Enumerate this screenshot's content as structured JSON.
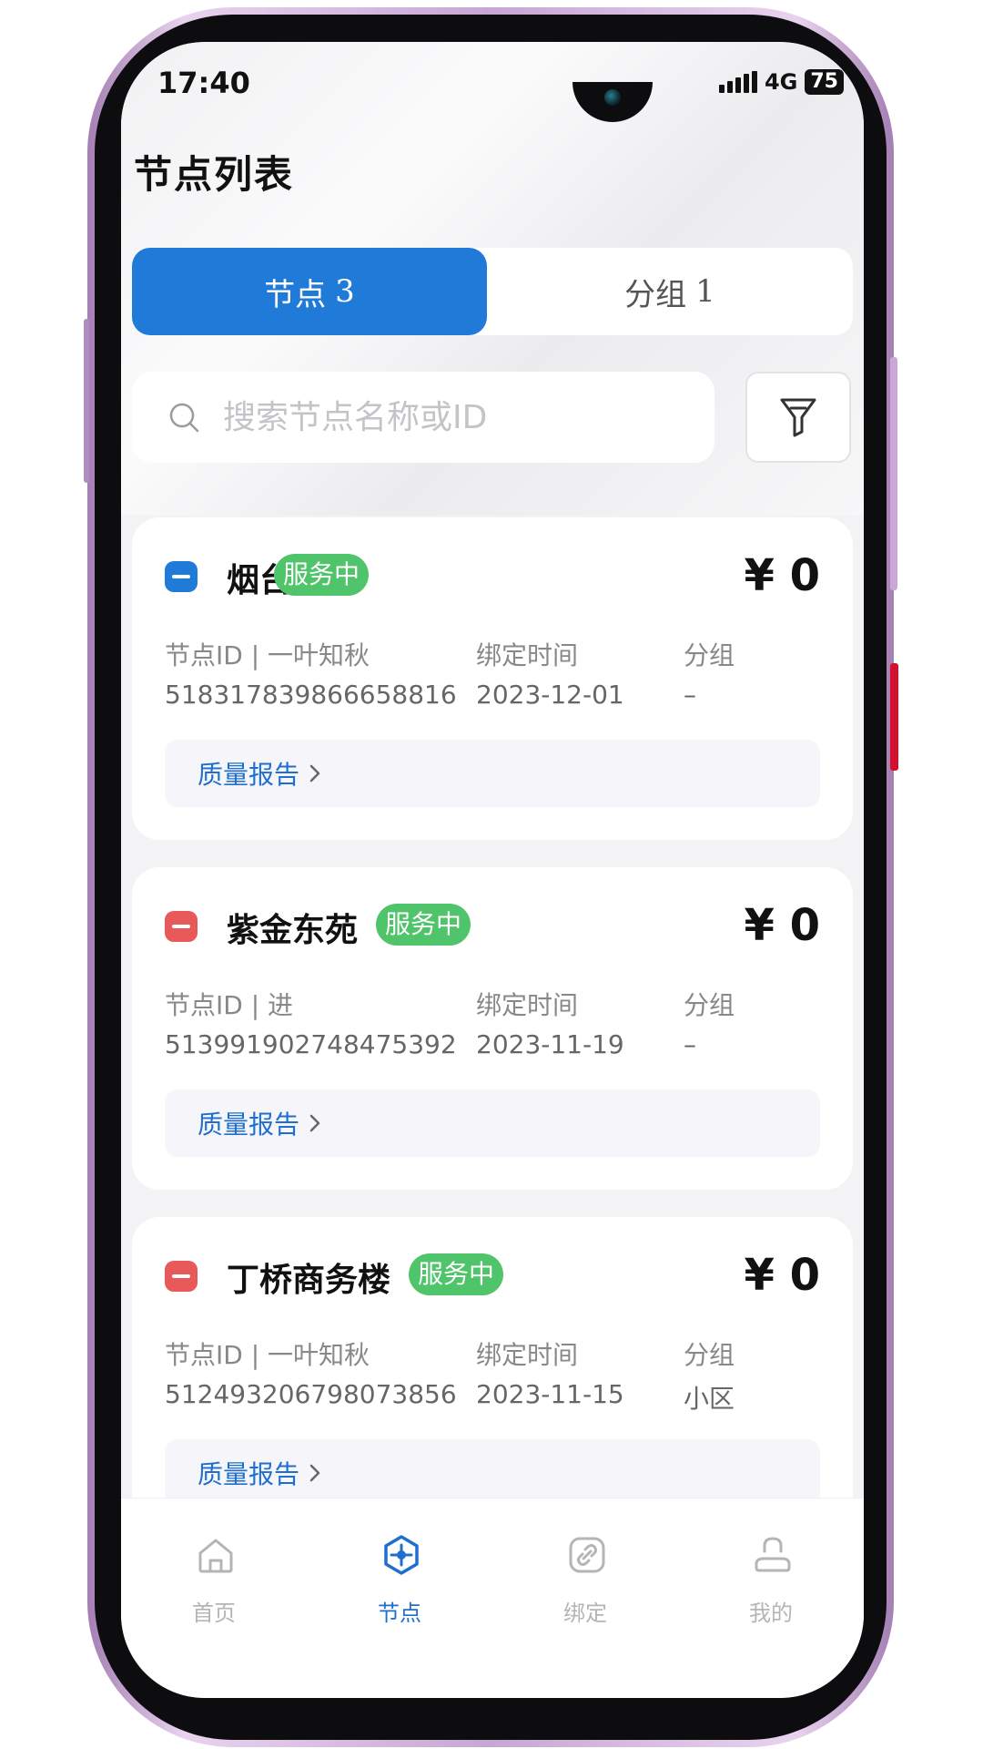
{
  "status_bar": {
    "time": "17:40",
    "network": "4G",
    "battery": "75"
  },
  "header": {
    "title": "节点列表"
  },
  "tabs": [
    {
      "label": "节点",
      "count": "3",
      "active": true
    },
    {
      "label": "分组",
      "count": "1",
      "active": false
    }
  ],
  "search": {
    "placeholder": "搜索节点名称或ID",
    "value": ""
  },
  "nodes": [
    {
      "name": "烟台",
      "status": "服务中",
      "price": "¥ 0",
      "icon_color": "blue",
      "id_label": "节点ID | 一叶知秋",
      "id_value": "518317839866658816",
      "bind_label": "绑定时间",
      "bind_value": "2023-12-01",
      "group_label": "分组",
      "group_value": "–",
      "report_label": "质量报告"
    },
    {
      "name": "紫金东苑",
      "status": "服务中",
      "price": "¥ 0",
      "icon_color": "red",
      "id_label": "节点ID | 进",
      "id_value": "513991902748475392",
      "bind_label": "绑定时间",
      "bind_value": "2023-11-19",
      "group_label": "分组",
      "group_value": "–",
      "report_label": "质量报告"
    },
    {
      "name": "丁桥商务楼",
      "status": "服务中",
      "price": "¥ 0",
      "icon_color": "red",
      "id_label": "节点ID | 一叶知秋",
      "id_value": "512493206798073856",
      "bind_label": "绑定时间",
      "bind_value": "2023-11-15",
      "group_label": "分组",
      "group_value": "小区",
      "report_label": "质量报告"
    }
  ],
  "bottom_nav": [
    {
      "label": "首页",
      "icon": "home-icon",
      "active": false
    },
    {
      "label": "节点",
      "icon": "node-icon",
      "active": true
    },
    {
      "label": "绑定",
      "icon": "link-icon",
      "active": false
    },
    {
      "label": "我的",
      "icon": "user-icon",
      "active": false
    }
  ],
  "colors": {
    "accent": "#1f7ad8",
    "status_green": "#4fc46a",
    "node_red": "#e8595a"
  }
}
